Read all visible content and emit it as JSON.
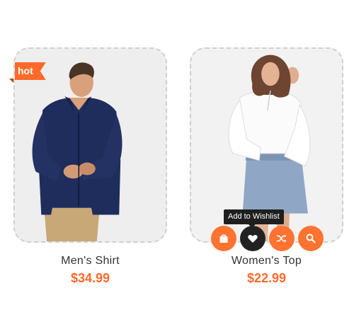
{
  "products": [
    {
      "title": "Men's Shirt",
      "price": "$34.99",
      "badge": "hot"
    },
    {
      "title": "Women's Top",
      "price": "$22.99",
      "tooltip": "Add to Wishlist"
    }
  ],
  "actions": [
    {
      "icon": "shopping-bag-icon"
    },
    {
      "icon": "heart-icon"
    },
    {
      "icon": "shuffle-icon"
    },
    {
      "icon": "search-icon"
    }
  ],
  "colors": {
    "accent": "#ff6a2b",
    "dark_button": "#222222",
    "frame_border": "#cfcfcf",
    "title_text": "#333333"
  }
}
